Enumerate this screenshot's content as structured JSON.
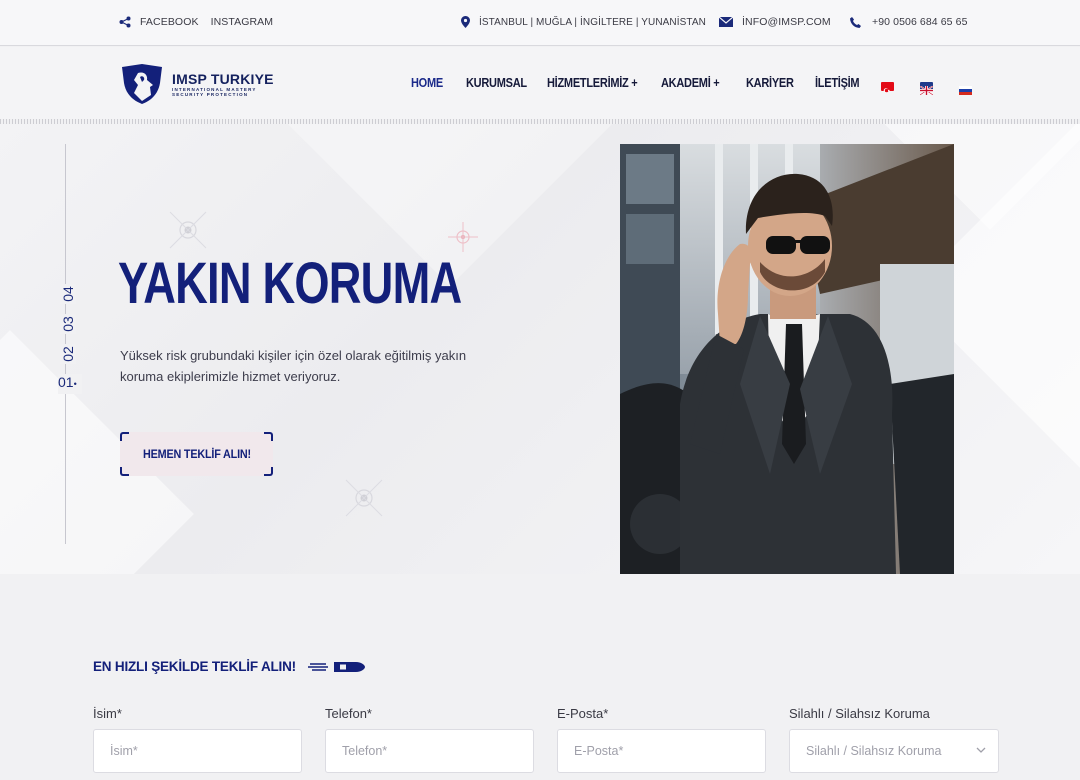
{
  "topbar": {
    "social": [
      "FACEBOOK",
      "INSTAGRAM"
    ],
    "locations": "İSTANBUL | MUĞLA | İNGİLTERE | YUNANİSTAN",
    "email": "İNFO@IMSP.COM",
    "phone": "+90 0506 684 65 65",
    "icons": [
      "share-icon",
      "location-pin-icon",
      "envelope-icon",
      "phone-icon"
    ]
  },
  "header": {
    "logo_title": "IMSP TURKIYE",
    "logo_subtitle_1": "INTERNATIONAL MASTERY",
    "logo_subtitle_2": "SECURITY PROTECTION",
    "nav": [
      "HOME",
      "KURUMSAL",
      "HİZMETLERİMİZ +",
      "AKADEMİ +",
      "KARİYER",
      "İLETİŞİM"
    ],
    "languages": [
      "Türkçe",
      "English",
      "Русский"
    ]
  },
  "hero": {
    "slide_numbers": [
      "04",
      "03",
      "02",
      "01"
    ],
    "active_slide": "01",
    "title": "YAKIN KORUMA",
    "text": "Yüksek risk grubundaki kişiler için özel olarak eğitilmiş yakın koruma ekiplerimizle hizmet veriyoruz.",
    "cta_label": "HEMEN TEKLİF ALIN!"
  },
  "form": {
    "title": "EN HIZLI ŞEKİLDE TEKLİF ALIN!",
    "fields": [
      {
        "label": "İsim*",
        "placeholder": "İsim*"
      },
      {
        "label": "Telefon*",
        "placeholder": "Telefon*"
      },
      {
        "label": "E-Posta*",
        "placeholder": "E-Posta*"
      }
    ],
    "select": {
      "label": "Silahlı / Silahsız Koruma",
      "value": "Silahlı / Silahsız Koruma"
    }
  },
  "colors": {
    "brand": "#13207a",
    "accent_bg": "#f1e8ec"
  }
}
